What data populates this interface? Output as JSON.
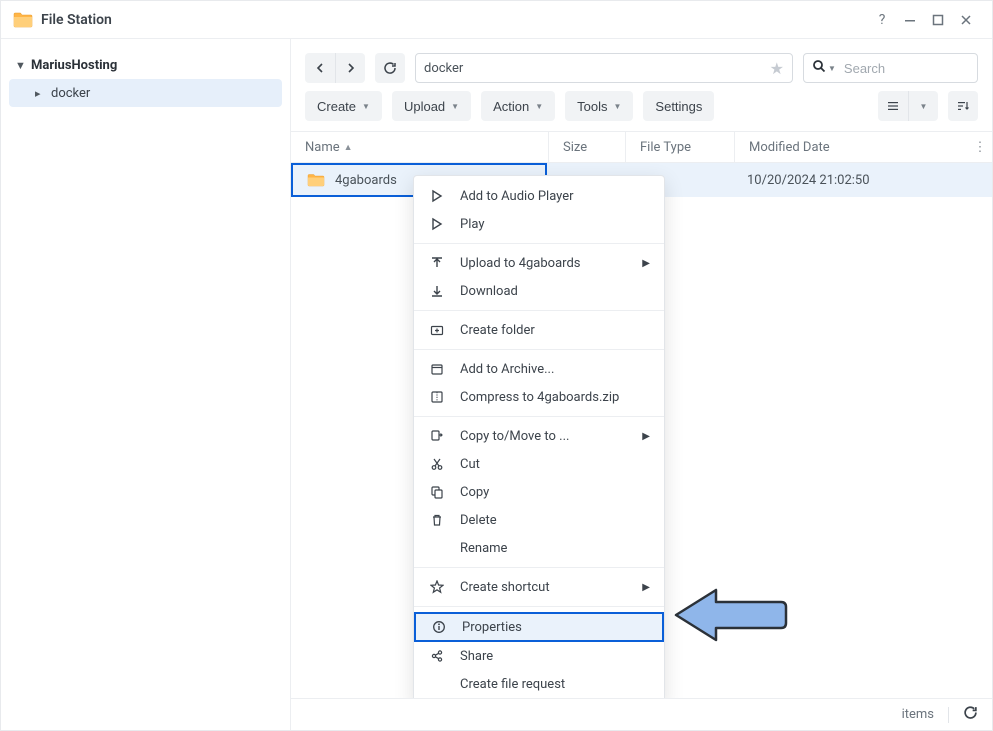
{
  "app": {
    "title": "File Station"
  },
  "sidebar": {
    "root": "MariusHosting",
    "items": [
      {
        "label": "docker"
      }
    ]
  },
  "path": {
    "current": "docker"
  },
  "search": {
    "placeholder": "Search"
  },
  "toolbar": {
    "create": "Create",
    "upload": "Upload",
    "action": "Action",
    "tools": "Tools",
    "settings": "Settings"
  },
  "columns": {
    "name": "Name",
    "size": "Size",
    "type": "File Type",
    "modified": "Modified Date"
  },
  "rows": [
    {
      "name": "4gaboards",
      "size": "",
      "type": "",
      "modified": "10/20/2024 21:02:50"
    }
  ],
  "context_menu": {
    "add_to_audio": "Add to Audio Player",
    "play": "Play",
    "upload_to": "Upload to 4gaboards",
    "download": "Download",
    "create_folder": "Create folder",
    "add_to_archive": "Add to Archive...",
    "compress": "Compress to 4gaboards.zip",
    "copy_move": "Copy to/Move to ...",
    "cut": "Cut",
    "copy": "Copy",
    "delete": "Delete",
    "rename": "Rename",
    "create_shortcut": "Create shortcut",
    "properties": "Properties",
    "share": "Share",
    "create_file_request": "Create file request"
  },
  "status": {
    "items": "items"
  }
}
